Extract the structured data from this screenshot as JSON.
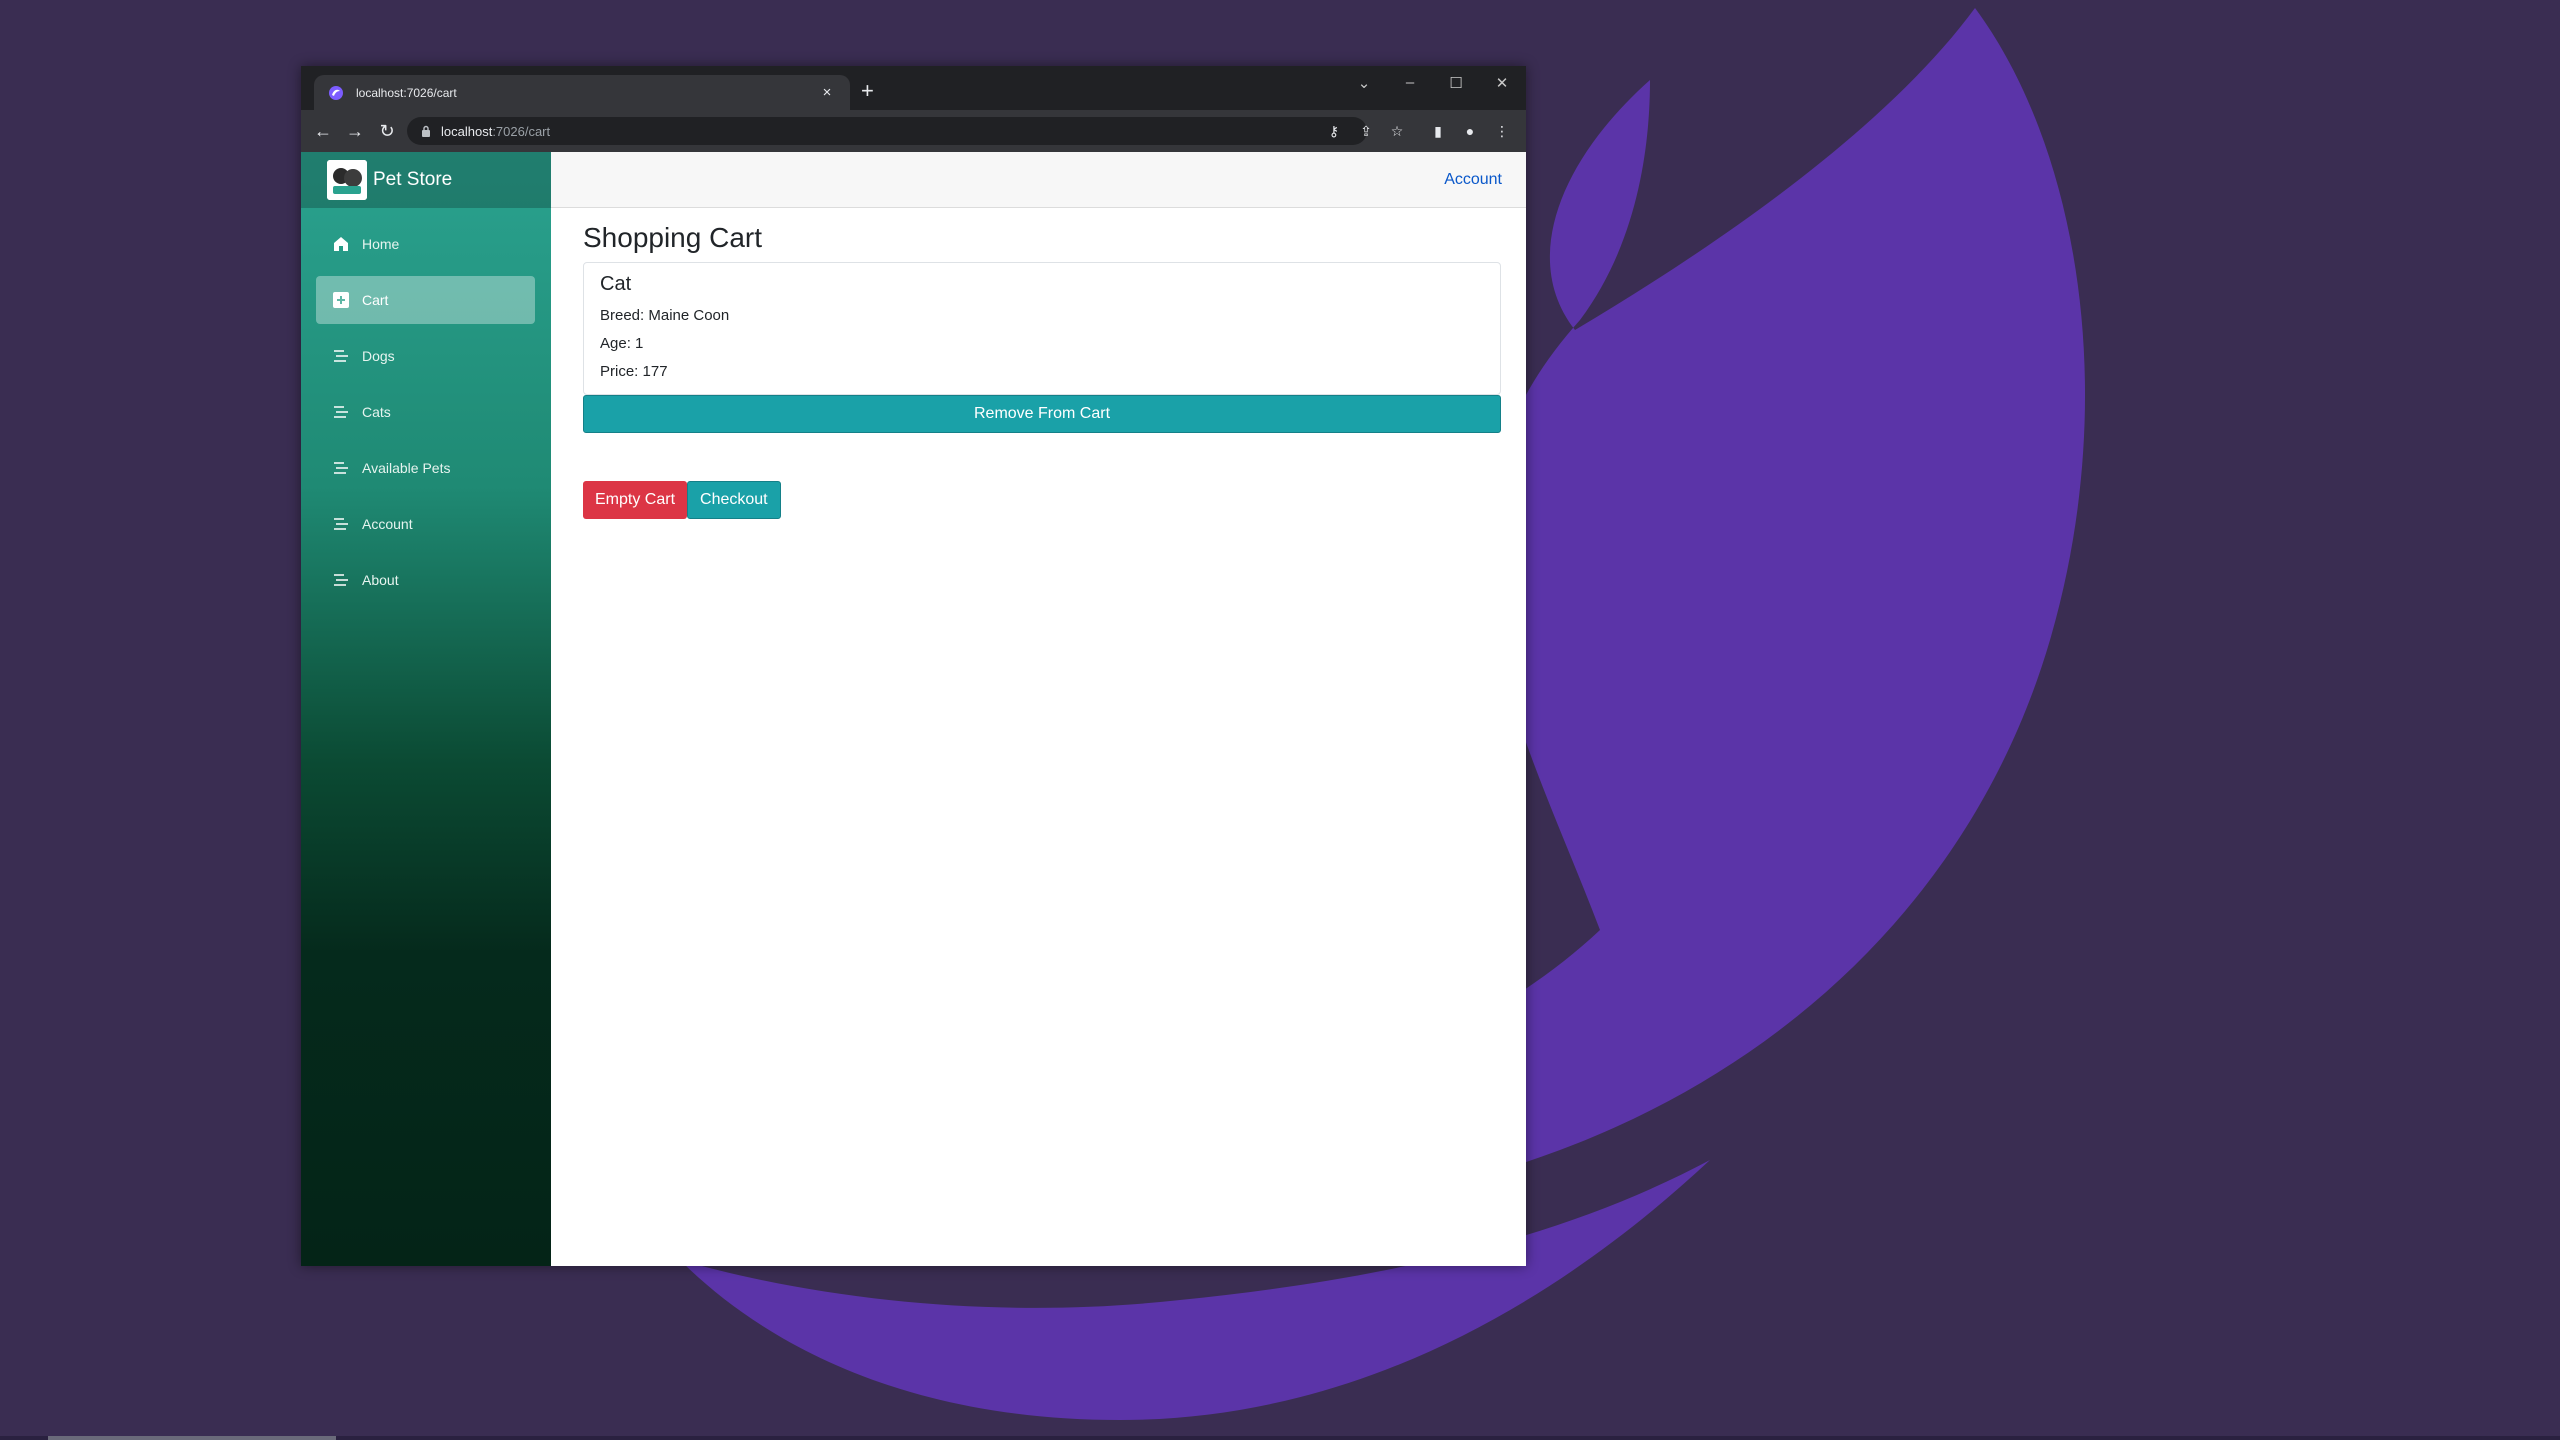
{
  "browser": {
    "tab_title": "localhost:7026/cart",
    "url_host": "localhost",
    "url_path": ":7026/cart",
    "new_tab": "+",
    "close_tab": "×"
  },
  "app": {
    "brand": "Pet Store",
    "nav": [
      {
        "label": "Home",
        "icon": "home-icon"
      },
      {
        "label": "Cart",
        "icon": "plus-square-icon"
      },
      {
        "label": "Dogs",
        "icon": "list-icon"
      },
      {
        "label": "Cats",
        "icon": "list-icon"
      },
      {
        "label": "Available Pets",
        "icon": "list-icon"
      },
      {
        "label": "Account",
        "icon": "list-icon"
      },
      {
        "label": "About",
        "icon": "list-icon"
      }
    ],
    "active_nav": "Cart",
    "top_link": "Account"
  },
  "cart": {
    "title": "Shopping Cart",
    "items": [
      {
        "name": "Cat",
        "breed": "Breed: Maine Coon",
        "age": "Age: 1",
        "price": "Price: 177",
        "remove_label": "Remove From Cart"
      }
    ],
    "empty_label": "Empty Cart",
    "checkout_label": "Checkout"
  },
  "colors": {
    "accent_teal": "#1aa1a8",
    "danger": "#dc3545",
    "link": "#0a58ca",
    "wallpaper": "#3a2d52",
    "swoosh": "#5b34a8"
  }
}
